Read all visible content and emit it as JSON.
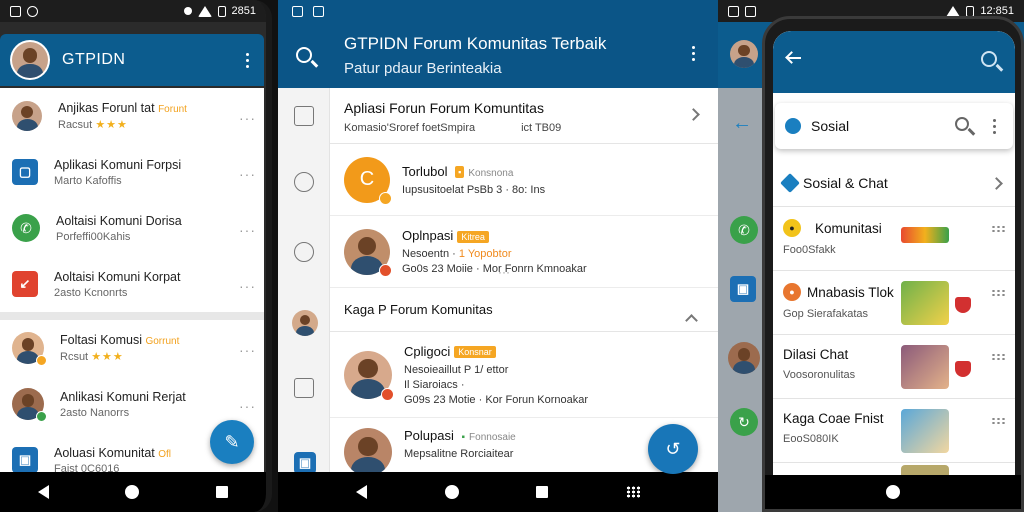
{
  "screen1": {
    "status": {
      "time": "2851"
    },
    "title": "GTPIDN",
    "items": [
      {
        "title": "Anjikas Forunl tat",
        "highlight": "Forunt",
        "subtitle": "Racsut",
        "stars": "★★★"
      },
      {
        "title": "Aplikasi Komuni Forpsi",
        "subtitle": "Marto Kafoffis"
      },
      {
        "title": "Aoltaisi Komuni Dorisa",
        "subtitle": "Porfeffi00Kahis"
      },
      {
        "title": "Aoltaisi Komuni Korpat",
        "subtitle": "2asto Kcnonrts"
      },
      {
        "title": "Foltasi Komusi",
        "highlight": "Gorrunt",
        "subtitle": "Rcsut",
        "stars": "★★★"
      },
      {
        "title": "Anlikasi Komuni Rerjat",
        "subtitle": "2asto Nanorrs"
      },
      {
        "title": "Aoluasi Komunitat",
        "highlight": "Ofl",
        "subtitle": "Faist 0C6016"
      }
    ],
    "colors": {
      "appbar": "#0c5c8e",
      "accent": "#f2a11d",
      "fab": "#1a7fc0"
    }
  },
  "screen2": {
    "title": "GTPIDN Forum Komunitas Terbaik",
    "subtitle": "Patur pdaur Berinteakia",
    "header": {
      "title": "Apliasi Forun Forum Komuntitas",
      "sub_left": "Komasio'Sroref foetSmpira",
      "sub_right": "ict TB09"
    },
    "entries": [
      {
        "title": "Torlubol",
        "sub": "Konsnona",
        "line1": "Iupsusitoelat PsBb 3 · 8o: Ins"
      },
      {
        "title": "Oplnpasi",
        "tag": "Kitrea",
        "line1": "Nesoentn ·",
        "orange": "1 Yopobtor",
        "line2": "Go0s 23 Moiie · Mor Fonrn Kmnoakar"
      }
    ],
    "section": "Kaga P Forum Komunitas",
    "entries2": [
      {
        "title": "Cpligoci",
        "tag": "Konsnar",
        "line1": "Nesoieaillut P 1/ ettor",
        "line2": "Il Siaroiacs ·",
        "line3": "G09s 23 Motie · Kor Forun Kornoakar"
      },
      {
        "title": "Polupasi",
        "sub": "Fonnosaie",
        "line1": "Mepsalitne Rorciaitear"
      }
    ]
  },
  "screen3": {
    "status": {
      "time": "12:851"
    },
    "search_label": "Sosial",
    "category": "Sosial & Chat",
    "rows": [
      {
        "title": "Komunitasi",
        "subtitle": "Foo0Sfakk"
      },
      {
        "title": "Mnabasis Tlok",
        "subtitle": "Gop Sierafakatas"
      },
      {
        "title": "Dilasi Chat",
        "subtitle": "Voosoronulitas"
      },
      {
        "title": "Kaga Coae Fnist",
        "subtitle": "EooS080IK"
      }
    ],
    "colors": {
      "appbar": "#0c5c8e",
      "red": "#d23030"
    }
  }
}
